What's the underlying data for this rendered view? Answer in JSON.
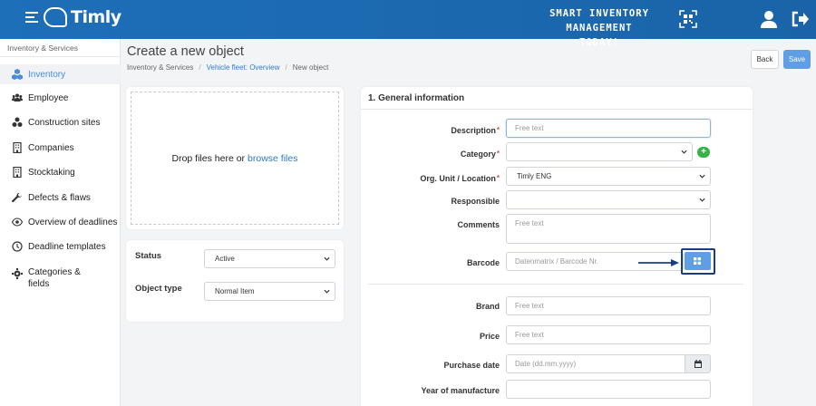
{
  "app": {
    "logo_text": "Timly",
    "slogan_line1": "SMART INVENTORY",
    "slogan_line2": "MANAGEMENT TODAY!"
  },
  "sidebar": {
    "breadcrumb": "Inventory & Services",
    "items": [
      {
        "label": "Inventory",
        "icon": "cubes-icon",
        "active": true
      },
      {
        "label": "Employee",
        "icon": "users-icon"
      },
      {
        "label": "Construction sites",
        "icon": "sites-icon"
      },
      {
        "label": "Companies",
        "icon": "building-icon"
      },
      {
        "label": "Stocktaking",
        "icon": "building-icon"
      },
      {
        "label": "Defects & flaws",
        "icon": "wrench-icon"
      },
      {
        "label": "Overview of deadlines",
        "icon": "eye-icon"
      },
      {
        "label": "Deadline templates",
        "icon": "clock-icon"
      },
      {
        "label": "Categories &\nfields",
        "icon": "cog-icon"
      }
    ]
  },
  "header": {
    "title": "Create a new object",
    "breadcrumb": [
      "Inventory & Services",
      "Vehicle fleet: Overview",
      "New object"
    ],
    "back_label": "Back",
    "save_label": "Save"
  },
  "upload": {
    "text": "Drop files here or",
    "link": "browse files"
  },
  "object_settings": {
    "status_label": "Status",
    "status_value": "Active",
    "type_label": "Object type",
    "type_value": "Normal Item"
  },
  "general": {
    "title": "1. General information",
    "description": {
      "label": "Description",
      "placeholder": "Free text"
    },
    "category": {
      "label": "Category",
      "value": ""
    },
    "org_unit": {
      "label": "Org. Unit / Location",
      "value": "Timly ENG"
    },
    "responsible": {
      "label": "Responsible",
      "value": ""
    },
    "comments": {
      "label": "Comments",
      "placeholder": "Free text"
    },
    "barcode": {
      "label": "Barcode",
      "placeholder": "Datenmatrix / Barcode Nr."
    },
    "brand": {
      "label": "Brand",
      "placeholder": "Free text"
    },
    "price": {
      "label": "Price",
      "placeholder": "Free text"
    },
    "purchase_date": {
      "label": "Purchase date",
      "placeholder": "Date (dd.mm.yyyy)"
    },
    "year": {
      "label": "Year of manufacture",
      "placeholder": ""
    }
  },
  "colors": {
    "topbar": "#1d6fb8",
    "accent": "#5f9ee5",
    "link": "#2d7cc8",
    "highlight": "#1a3e86",
    "add": "#35b24a",
    "required": "#d9534f"
  }
}
